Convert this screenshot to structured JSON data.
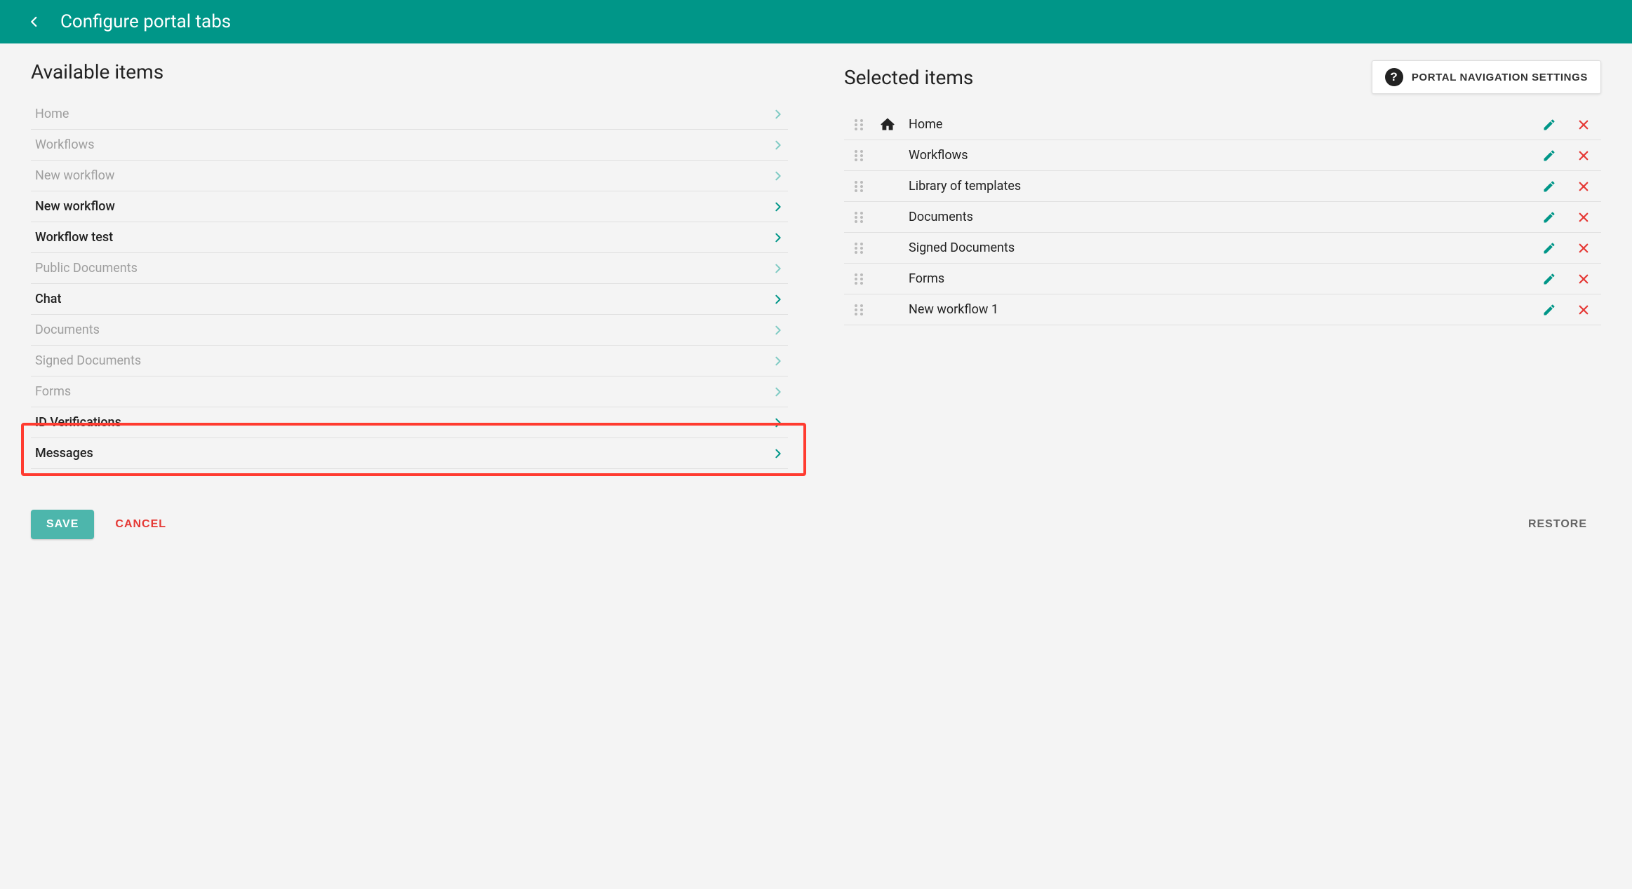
{
  "header": {
    "title": "Configure portal tabs"
  },
  "sections": {
    "available_title": "Available items",
    "selected_title": "Selected items",
    "portal_nav_button": "PORTAL NAVIGATION SETTINGS"
  },
  "available": [
    {
      "label": "Home",
      "muted": true
    },
    {
      "label": "Workflows",
      "muted": true
    },
    {
      "label": "New workflow",
      "muted": true
    },
    {
      "label": "New workflow",
      "muted": false
    },
    {
      "label": "Workflow test",
      "muted": false
    },
    {
      "label": "Public Documents",
      "muted": true
    },
    {
      "label": "Chat",
      "muted": false
    },
    {
      "label": "Documents",
      "muted": true
    },
    {
      "label": "Signed Documents",
      "muted": true
    },
    {
      "label": "Forms",
      "muted": true
    },
    {
      "label": "ID Verifications",
      "muted": false
    },
    {
      "label": "Messages",
      "muted": false,
      "highlight": true
    }
  ],
  "selected": [
    {
      "label": "Home",
      "icon": "home"
    },
    {
      "label": "Workflows"
    },
    {
      "label": "Library of templates"
    },
    {
      "label": "Documents"
    },
    {
      "label": "Signed Documents"
    },
    {
      "label": "Forms"
    },
    {
      "label": "New workflow 1"
    }
  ],
  "actions": {
    "save": "SAVE",
    "cancel": "CANCEL",
    "restore": "RESTORE"
  },
  "colors": {
    "primary": "#009688",
    "danger": "#e53935"
  }
}
